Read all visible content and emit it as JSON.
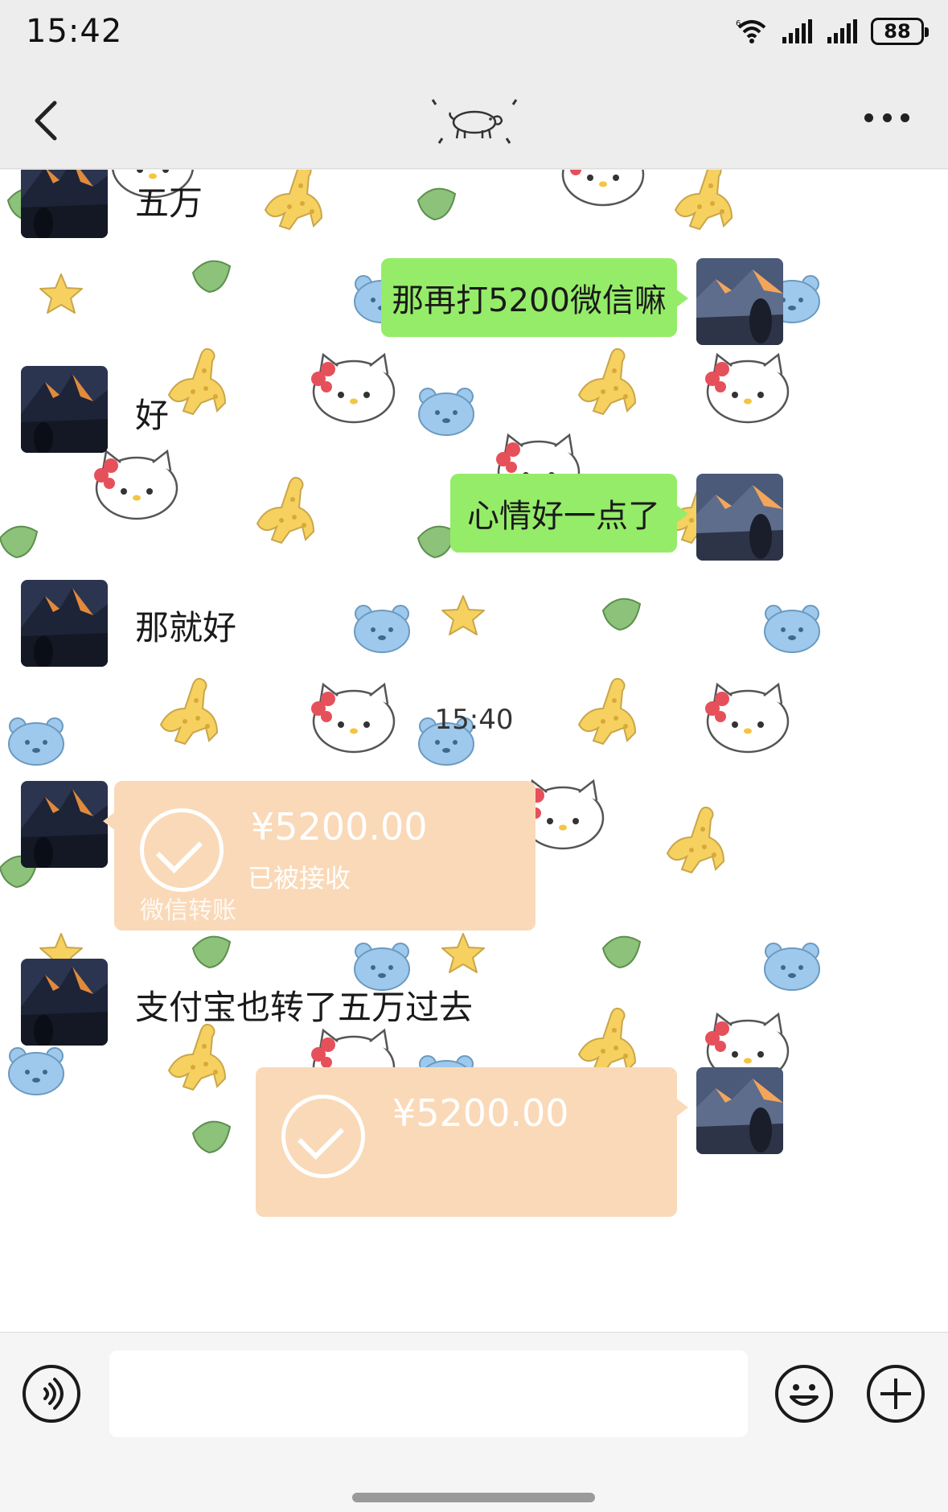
{
  "status_bar": {
    "time": "15:42",
    "battery": "88",
    "icons": [
      "wifi-icon",
      "signal-icon",
      "signal-icon"
    ]
  },
  "nav": {
    "back_icon": "chevron-left-icon",
    "title_icon": "pig-doodle-icon",
    "more_icon": "more-dots-icon"
  },
  "messages": [
    {
      "side": "left",
      "type": "text",
      "text": "五万"
    },
    {
      "side": "right",
      "type": "text",
      "text": "那再打5200微信嘛"
    },
    {
      "side": "left",
      "type": "text",
      "text": "好"
    },
    {
      "side": "right",
      "type": "text",
      "text": "心情好一点了"
    },
    {
      "side": "left",
      "type": "text",
      "text": "那就好"
    },
    {
      "type": "timestamp",
      "text": "15:40"
    },
    {
      "side": "left",
      "type": "transfer",
      "amount": "¥5200.00",
      "status": "已被接收",
      "footer": "微信转账"
    },
    {
      "side": "left",
      "type": "text",
      "text": "支付宝也转了五万过去"
    },
    {
      "side": "right",
      "type": "transfer",
      "amount": "¥5200.00",
      "status": "",
      "footer": ""
    }
  ],
  "input": {
    "value": "",
    "voice_icon": "voice-icon",
    "emoji_icon": "emoji-icon",
    "plus_icon": "plus-icon"
  },
  "colors": {
    "bubble_green": "#95ec69",
    "transfer_bg": "#fad9b8",
    "page_bg": "#ededed"
  }
}
